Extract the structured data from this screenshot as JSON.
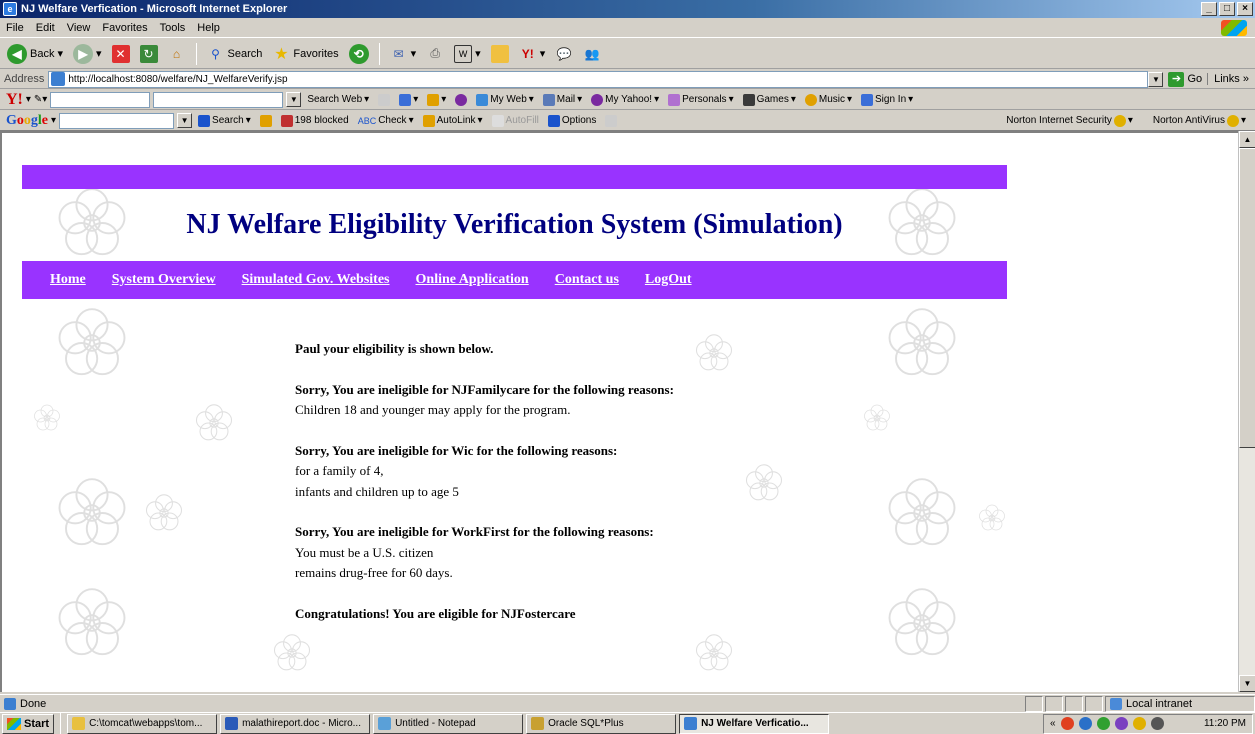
{
  "window": {
    "title": "NJ Welfare Verfication - Microsoft Internet Explorer",
    "controls": [
      "_",
      "□",
      "×"
    ]
  },
  "menu": [
    "File",
    "Edit",
    "View",
    "Favorites",
    "Tools",
    "Help"
  ],
  "toolbar": {
    "back_label": "Back",
    "search_label": "Search",
    "favorites_label": "Favorites"
  },
  "address": {
    "label": "Address",
    "url": "http://localhost:8080/welfare/NJ_WelfareVerify.jsp",
    "go_label": "Go",
    "links_label": "Links"
  },
  "yahoo_bar": {
    "search_web_label": "Search Web",
    "my_web_label": "My Web",
    "mail_label": "Mail",
    "my_yahoo_label": "My Yahoo!",
    "personals_label": "Personals",
    "games_label": "Games",
    "music_label": "Music",
    "sign_in_label": "Sign In"
  },
  "google_bar": {
    "search_label": "Search",
    "blocked_label": "198 blocked",
    "check_label": "Check",
    "autolink_label": "AutoLink",
    "autofill_label": "AutoFill",
    "options_label": "Options",
    "norton_security_label": "Norton Internet Security",
    "norton_antivirus_label": "Norton AntiVirus"
  },
  "site": {
    "title": "NJ Welfare Eligibility Verification System (Simulation)",
    "nav": [
      "Home",
      "System Overview",
      "Simulated Gov. Websites",
      "Online Application",
      "Contact us",
      "LogOut"
    ]
  },
  "results": {
    "intro": "Paul your eligibility is shown below.",
    "njfamilycare": {
      "heading": "Sorry, You are ineligible for NJFamilycare for the following reasons:",
      "reasons": [
        "Children 18 and younger may apply for the program."
      ]
    },
    "wic": {
      "heading": "Sorry, You are ineligible for Wic for the following reasons:",
      "reasons": [
        "for a family of 4,",
        "infants and children up to age 5"
      ]
    },
    "workfirst": {
      "heading": "Sorry, You are ineligible for WorkFirst for the following reasons:",
      "reasons": [
        "You must be a U.S. citizen",
        "remains drug-free for 60 days."
      ]
    },
    "fostercare": "Congratulations! You are eligible for NJFostercare"
  },
  "status": {
    "text": "Done",
    "zone": "Local intranet"
  },
  "taskbar": {
    "start_label": "Start",
    "buttons": [
      "C:\\tomcat\\webapps\\tom...",
      "malathireport.doc - Micro...",
      "Untitled - Notepad",
      "Oracle SQL*Plus",
      "NJ Welfare Verficatio..."
    ],
    "clock": "11:20 PM"
  },
  "colors": {
    "site_purple": "#9933ff",
    "site_title": "#000080",
    "titlebar_blue": "#0a246a"
  }
}
